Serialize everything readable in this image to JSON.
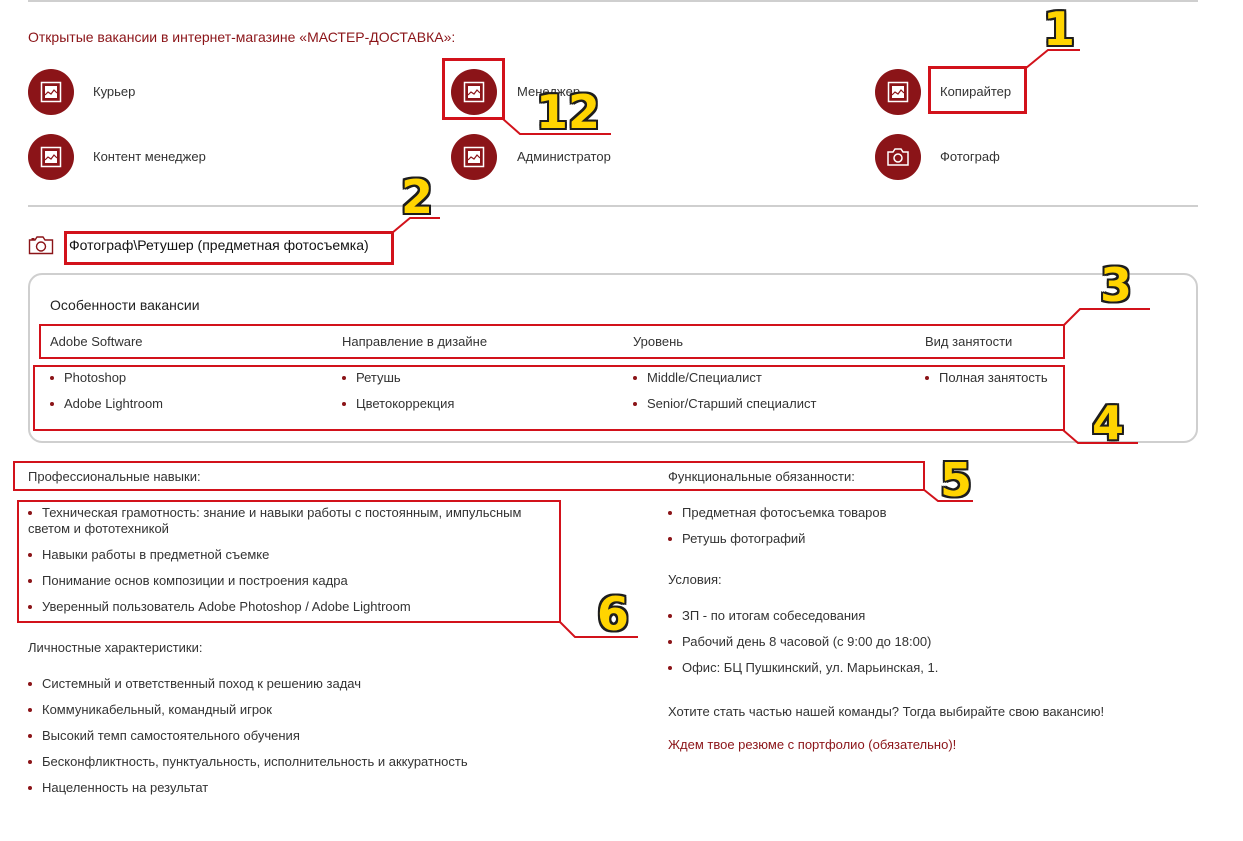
{
  "vacancies": {
    "title": "Открытые вакансии в интернет-магазине «МАСТЕР-ДОСТАВКА»:",
    "items": [
      {
        "label": "Курьер",
        "icon": "image-icon"
      },
      {
        "label": "Менеджер",
        "icon": "image-icon"
      },
      {
        "label": "Копирайтер",
        "icon": "image-icon"
      },
      {
        "label": "Контент менеджер",
        "icon": "image-icon"
      },
      {
        "label": "Администратор",
        "icon": "image-icon"
      },
      {
        "label": "Фотограф",
        "icon": "camera-icon"
      }
    ]
  },
  "vacancy": {
    "title": "Фотограф\\Ретушер (предметная фотосъемка)",
    "title_icon": "camera-outline-icon",
    "features": {
      "heading": "Особенности вакансии",
      "columns": [
        {
          "header": "Adobe Software",
          "items": [
            "Photoshop",
            "Adobe Lightroom"
          ]
        },
        {
          "header": "Направление в дизайне",
          "items": [
            "Ретушь",
            "Цветокоррекция"
          ]
        },
        {
          "header": "Уровень",
          "items": [
            "Middle/Специалист",
            "Senior/Старший специалист"
          ]
        },
        {
          "header": "Вид занятости",
          "items": [
            "Полная занятость"
          ]
        }
      ]
    },
    "skills": {
      "heading": "Профессиональные навыки:",
      "items": [
        "Техническая грамотность: знание и навыки работы с постоянным, импульсным светом и фототехникой",
        "Навыки работы в предметной съемке",
        "Понимание основ композиции и построения кадра",
        "Уверенный пользователь Adobe Photoshop / Adobe Lightroom"
      ]
    },
    "personal": {
      "heading": "Личностные характеристики:",
      "items": [
        "Системный и ответственный поход к решению задач",
        "Коммуникабельный, командный игрок",
        "Высокий темп самостоятельного обучения",
        "Бесконфликтность, пунктуальность, исполнительность и аккуратность",
        "Нацеленность на результат"
      ]
    },
    "duties": {
      "heading": "Функциональные обязанности:",
      "items": [
        "Предметная фотосъемка товаров",
        "Ретушь фотографий"
      ]
    },
    "conditions": {
      "heading": "Условия:",
      "items": [
        "ЗП - по итогам собеседования",
        "Рабочий день 8 часовой (с 9:00 до 18:00)",
        "Офис: БЦ Пушкинский, ул. Марьинская, 1."
      ]
    },
    "cta": "Хотите стать частью нашей команды? Тогда выбирайте свою вакансию!",
    "resume": "Ждем твое резюме с портфолио (обязательно)!"
  },
  "annotations": [
    "1",
    "12",
    "2",
    "3",
    "4",
    "5",
    "6"
  ],
  "colors": {
    "brand": "#8b1418",
    "annotation_box": "#d2121b",
    "annotation_number": "#ffd400"
  }
}
